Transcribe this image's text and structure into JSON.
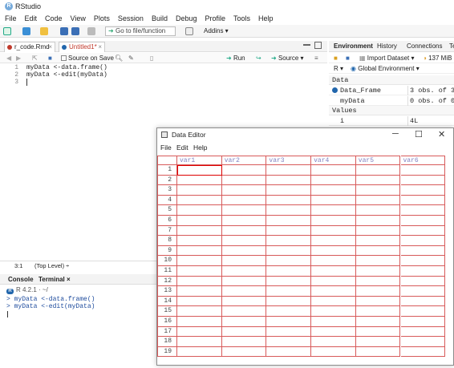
{
  "app": {
    "title": "RStudio"
  },
  "menu": [
    "File",
    "Edit",
    "Code",
    "View",
    "Plots",
    "Session",
    "Build",
    "Debug",
    "Profile",
    "Tools",
    "Help"
  ],
  "toolbar": {
    "goto_placeholder": "Go to file/function",
    "addins": "Addins ▾"
  },
  "editor": {
    "tabs": [
      {
        "label": "r_code.Rmd",
        "dot_color": "#c0392b"
      },
      {
        "label": "Untitled1*",
        "dot_color": "#2166ac",
        "unsaved_color": "#c0392b"
      }
    ],
    "source_on_save": "Source on Save",
    "run": "Run",
    "source": "Source ▾",
    "lines": [
      {
        "num": "1",
        "text": "myData <-data.frame()"
      },
      {
        "num": "2",
        "text": "myData <-edit(myData)"
      },
      {
        "num": "3",
        "text": ""
      }
    ],
    "status_pos": "3:1",
    "status_scope": "(Top Level) ÷"
  },
  "console": {
    "tabs": [
      "Console",
      "Terminal ×"
    ],
    "path": "R 4.2.1 · ~/",
    "lines": [
      "> myData <-data.frame()",
      "> myData <-edit(myData)"
    ]
  },
  "environment": {
    "tabs": [
      "Environment",
      "History",
      "Connections",
      "Te"
    ],
    "import_dataset": "Import Dataset ▾",
    "memory": "137 MiB",
    "r_select": "R ▾",
    "global_env": "Global Environment ▾",
    "section_data": "Data",
    "section_values": "Values",
    "data_rows": [
      {
        "name": "Data_Frame",
        "value": "3 obs. of 3"
      },
      {
        "name": "myData",
        "value": "0 obs. of 0"
      }
    ],
    "value_rows": [
      {
        "name": "i",
        "value": "4L"
      }
    ]
  },
  "data_editor": {
    "title": "Data Editor",
    "menu": [
      "File",
      "Edit",
      "Help"
    ],
    "columns": [
      "var1",
      "var2",
      "var3",
      "var4",
      "var5",
      "var6"
    ],
    "rows": [
      "1",
      "2",
      "3",
      "4",
      "5",
      "6",
      "7",
      "8",
      "9",
      "10",
      "11",
      "12",
      "13",
      "14",
      "15",
      "16",
      "17",
      "18",
      "19"
    ],
    "grid_color": "#d75a5a",
    "header_color": "#8080c0"
  }
}
